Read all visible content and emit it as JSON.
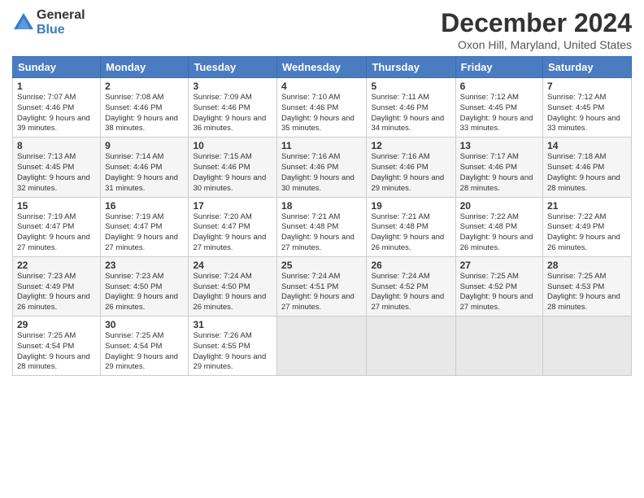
{
  "logo": {
    "general": "General",
    "blue": "Blue"
  },
  "title": "December 2024",
  "location": "Oxon Hill, Maryland, United States",
  "days_header": [
    "Sunday",
    "Monday",
    "Tuesday",
    "Wednesday",
    "Thursday",
    "Friday",
    "Saturday"
  ],
  "weeks": [
    [
      {
        "day": "1",
        "sunrise": "Sunrise: 7:07 AM",
        "sunset": "Sunset: 4:46 PM",
        "daylight": "Daylight: 9 hours and 39 minutes."
      },
      {
        "day": "2",
        "sunrise": "Sunrise: 7:08 AM",
        "sunset": "Sunset: 4:46 PM",
        "daylight": "Daylight: 9 hours and 38 minutes."
      },
      {
        "day": "3",
        "sunrise": "Sunrise: 7:09 AM",
        "sunset": "Sunset: 4:46 PM",
        "daylight": "Daylight: 9 hours and 36 minutes."
      },
      {
        "day": "4",
        "sunrise": "Sunrise: 7:10 AM",
        "sunset": "Sunset: 4:46 PM",
        "daylight": "Daylight: 9 hours and 35 minutes."
      },
      {
        "day": "5",
        "sunrise": "Sunrise: 7:11 AM",
        "sunset": "Sunset: 4:46 PM",
        "daylight": "Daylight: 9 hours and 34 minutes."
      },
      {
        "day": "6",
        "sunrise": "Sunrise: 7:12 AM",
        "sunset": "Sunset: 4:45 PM",
        "daylight": "Daylight: 9 hours and 33 minutes."
      },
      {
        "day": "7",
        "sunrise": "Sunrise: 7:12 AM",
        "sunset": "Sunset: 4:45 PM",
        "daylight": "Daylight: 9 hours and 33 minutes."
      }
    ],
    [
      {
        "day": "8",
        "sunrise": "Sunrise: 7:13 AM",
        "sunset": "Sunset: 4:45 PM",
        "daylight": "Daylight: 9 hours and 32 minutes."
      },
      {
        "day": "9",
        "sunrise": "Sunrise: 7:14 AM",
        "sunset": "Sunset: 4:46 PM",
        "daylight": "Daylight: 9 hours and 31 minutes."
      },
      {
        "day": "10",
        "sunrise": "Sunrise: 7:15 AM",
        "sunset": "Sunset: 4:46 PM",
        "daylight": "Daylight: 9 hours and 30 minutes."
      },
      {
        "day": "11",
        "sunrise": "Sunrise: 7:16 AM",
        "sunset": "Sunset: 4:46 PM",
        "daylight": "Daylight: 9 hours and 30 minutes."
      },
      {
        "day": "12",
        "sunrise": "Sunrise: 7:16 AM",
        "sunset": "Sunset: 4:46 PM",
        "daylight": "Daylight: 9 hours and 29 minutes."
      },
      {
        "day": "13",
        "sunrise": "Sunrise: 7:17 AM",
        "sunset": "Sunset: 4:46 PM",
        "daylight": "Daylight: 9 hours and 28 minutes."
      },
      {
        "day": "14",
        "sunrise": "Sunrise: 7:18 AM",
        "sunset": "Sunset: 4:46 PM",
        "daylight": "Daylight: 9 hours and 28 minutes."
      }
    ],
    [
      {
        "day": "15",
        "sunrise": "Sunrise: 7:19 AM",
        "sunset": "Sunset: 4:47 PM",
        "daylight": "Daylight: 9 hours and 27 minutes."
      },
      {
        "day": "16",
        "sunrise": "Sunrise: 7:19 AM",
        "sunset": "Sunset: 4:47 PM",
        "daylight": "Daylight: 9 hours and 27 minutes."
      },
      {
        "day": "17",
        "sunrise": "Sunrise: 7:20 AM",
        "sunset": "Sunset: 4:47 PM",
        "daylight": "Daylight: 9 hours and 27 minutes."
      },
      {
        "day": "18",
        "sunrise": "Sunrise: 7:21 AM",
        "sunset": "Sunset: 4:48 PM",
        "daylight": "Daylight: 9 hours and 27 minutes."
      },
      {
        "day": "19",
        "sunrise": "Sunrise: 7:21 AM",
        "sunset": "Sunset: 4:48 PM",
        "daylight": "Daylight: 9 hours and 26 minutes."
      },
      {
        "day": "20",
        "sunrise": "Sunrise: 7:22 AM",
        "sunset": "Sunset: 4:48 PM",
        "daylight": "Daylight: 9 hours and 26 minutes."
      },
      {
        "day": "21",
        "sunrise": "Sunrise: 7:22 AM",
        "sunset": "Sunset: 4:49 PM",
        "daylight": "Daylight: 9 hours and 26 minutes."
      }
    ],
    [
      {
        "day": "22",
        "sunrise": "Sunrise: 7:23 AM",
        "sunset": "Sunset: 4:49 PM",
        "daylight": "Daylight: 9 hours and 26 minutes."
      },
      {
        "day": "23",
        "sunrise": "Sunrise: 7:23 AM",
        "sunset": "Sunset: 4:50 PM",
        "daylight": "Daylight: 9 hours and 26 minutes."
      },
      {
        "day": "24",
        "sunrise": "Sunrise: 7:24 AM",
        "sunset": "Sunset: 4:50 PM",
        "daylight": "Daylight: 9 hours and 26 minutes."
      },
      {
        "day": "25",
        "sunrise": "Sunrise: 7:24 AM",
        "sunset": "Sunset: 4:51 PM",
        "daylight": "Daylight: 9 hours and 27 minutes."
      },
      {
        "day": "26",
        "sunrise": "Sunrise: 7:24 AM",
        "sunset": "Sunset: 4:52 PM",
        "daylight": "Daylight: 9 hours and 27 minutes."
      },
      {
        "day": "27",
        "sunrise": "Sunrise: 7:25 AM",
        "sunset": "Sunset: 4:52 PM",
        "daylight": "Daylight: 9 hours and 27 minutes."
      },
      {
        "day": "28",
        "sunrise": "Sunrise: 7:25 AM",
        "sunset": "Sunset: 4:53 PM",
        "daylight": "Daylight: 9 hours and 28 minutes."
      }
    ],
    [
      {
        "day": "29",
        "sunrise": "Sunrise: 7:25 AM",
        "sunset": "Sunset: 4:54 PM",
        "daylight": "Daylight: 9 hours and 28 minutes."
      },
      {
        "day": "30",
        "sunrise": "Sunrise: 7:25 AM",
        "sunset": "Sunset: 4:54 PM",
        "daylight": "Daylight: 9 hours and 29 minutes."
      },
      {
        "day": "31",
        "sunrise": "Sunrise: 7:26 AM",
        "sunset": "Sunset: 4:55 PM",
        "daylight": "Daylight: 9 hours and 29 minutes."
      },
      null,
      null,
      null,
      null
    ]
  ]
}
